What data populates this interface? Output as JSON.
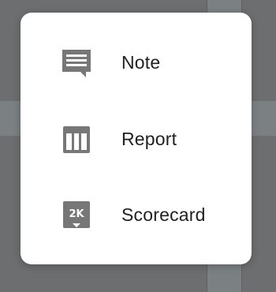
{
  "menu": {
    "items": [
      {
        "label": "Note",
        "icon": "note-icon"
      },
      {
        "label": "Report",
        "icon": "report-icon"
      },
      {
        "label": "Scorecard",
        "icon": "scorecard-icon"
      }
    ],
    "scorecard_icon_text": "2K"
  },
  "colors": {
    "icon": "#777777",
    "text": "#202124",
    "backdrop": "#6d6e70",
    "card": "#ffffff"
  }
}
